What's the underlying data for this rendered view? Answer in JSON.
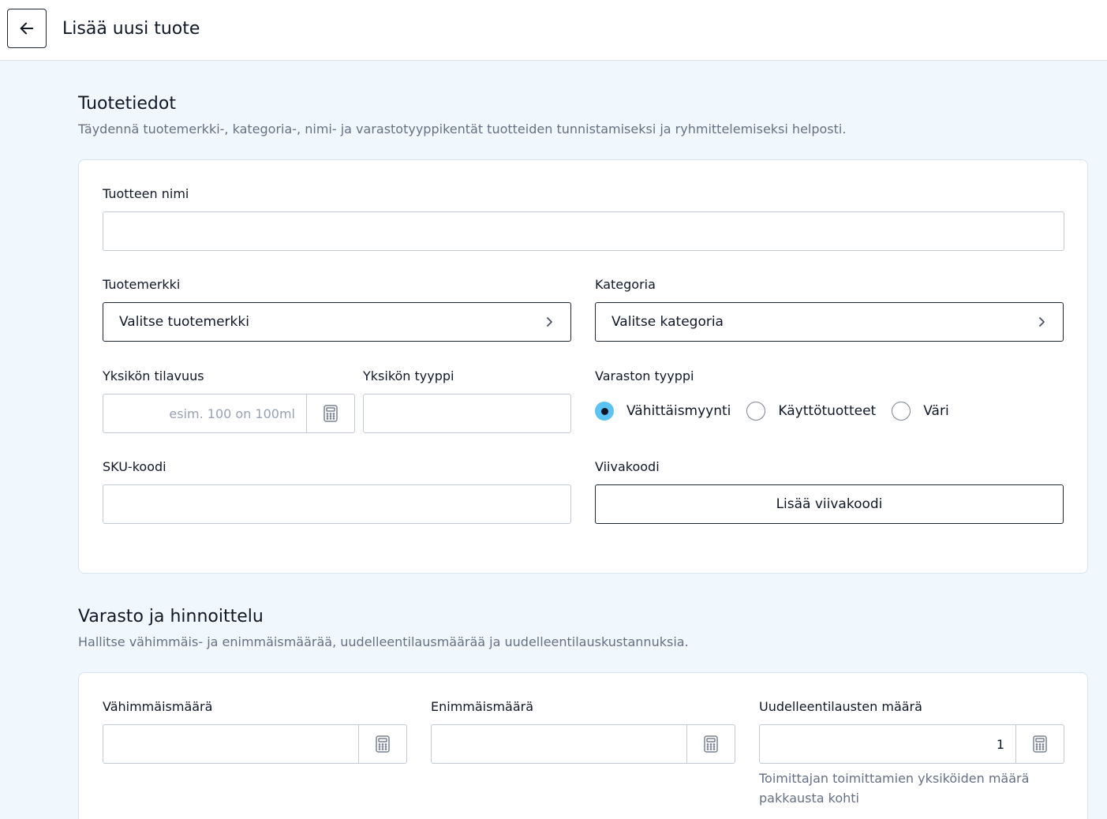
{
  "header": {
    "title": "Lisää uusi tuote"
  },
  "product_section": {
    "title": "Tuotetiedot",
    "description": "Täydennä tuotemerkki-, kategoria-, nimi- ja varastotyyppikentät tuotteiden tunnistamiseksi ja ryhmittelemiseksi helposti.",
    "name_label": "Tuotteen nimi",
    "name_value": "",
    "brand_label": "Tuotemerkki",
    "brand_value": "Valitse tuotemerkki",
    "category_label": "Kategoria",
    "category_value": "Valitse kategoria",
    "unit_volume_label": "Yksikön tilavuus",
    "unit_volume_placeholder": "esim. 100 on 100ml",
    "unit_type_label": "Yksikön tyyppi",
    "unit_type_value": "",
    "stock_type_label": "Varaston tyyppi",
    "stock_type_options": [
      {
        "label": "Vähittäismyynti",
        "checked": true
      },
      {
        "label": "Käyttötuotteet",
        "checked": false
      },
      {
        "label": "Väri",
        "checked": false
      }
    ],
    "sku_label": "SKU-koodi",
    "sku_value": "",
    "barcode_label": "Viivakoodi",
    "barcode_button": "Lisää viivakoodi"
  },
  "stock_section": {
    "title": "Varasto ja hinnoittelu",
    "description": "Hallitse vähimmäis- ja enimmäismäärää, uudelleentilausmäärää ja uudelleentilauskustannuksia.",
    "min_label": "Vähimmäismäärä",
    "min_value": "",
    "max_label": "Enimmäismäärä",
    "max_value": "",
    "reorder_label": "Uudelleentilausten määrä",
    "reorder_value": "1",
    "reorder_helper": "Toimittajan toimittamien yksiköiden määrä pakkausta kohti"
  },
  "icons": {
    "back": "arrow-left-icon",
    "chevron": "chevron-right-icon",
    "calculator": "calculator-icon"
  },
  "colors": {
    "accent": "#5cc3f5",
    "background": "#f0f7fd",
    "border_dark": "#1d2433"
  }
}
